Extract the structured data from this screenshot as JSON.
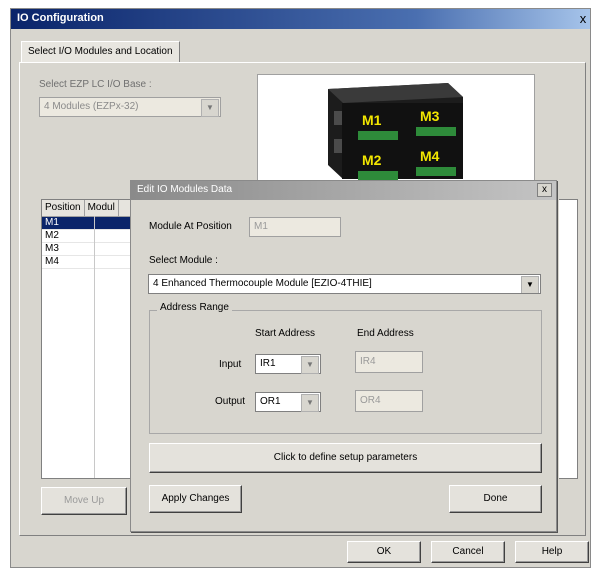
{
  "window": {
    "title": "IO Configuration",
    "close_glyph": "x"
  },
  "tab": {
    "label": "Select I/O Modules and Location"
  },
  "base": {
    "label": "Select EZP LC I/O Base :",
    "value": "4 Modules (EZPx-32)"
  },
  "position_list": {
    "headers": [
      "Position",
      "Modul"
    ],
    "rows": [
      "M1",
      "M2",
      "M3",
      "M4"
    ]
  },
  "module_image": {
    "labels": [
      "M1",
      "M3",
      "M2",
      "M4"
    ]
  },
  "buttons": {
    "move_up": "Move Up",
    "ok": "OK",
    "cancel": "Cancel",
    "help": "Help"
  },
  "dialog": {
    "title": "Edit IO Modules Data",
    "close_glyph": "x",
    "module_at_position_label": "Module At Position",
    "module_at_position_value": "M1",
    "select_module_label": "Select Module :",
    "select_module_value": "4 Enhanced Thermocouple Module [EZIO-4THIE]",
    "address_range": {
      "legend": "Address Range",
      "start_header": "Start Address",
      "end_header": "End Address",
      "input_label": "Input",
      "input_start": "IR1",
      "input_end": "IR4",
      "output_label": "Output",
      "output_start": "OR1",
      "output_end": "OR4"
    },
    "setup_button": "Click to define setup parameters",
    "apply_button": "Apply Changes",
    "done_button": "Done"
  },
  "colors": {
    "titlebar": "#0a246a",
    "selection": "#0a246a",
    "module_label": "#f2e600"
  }
}
